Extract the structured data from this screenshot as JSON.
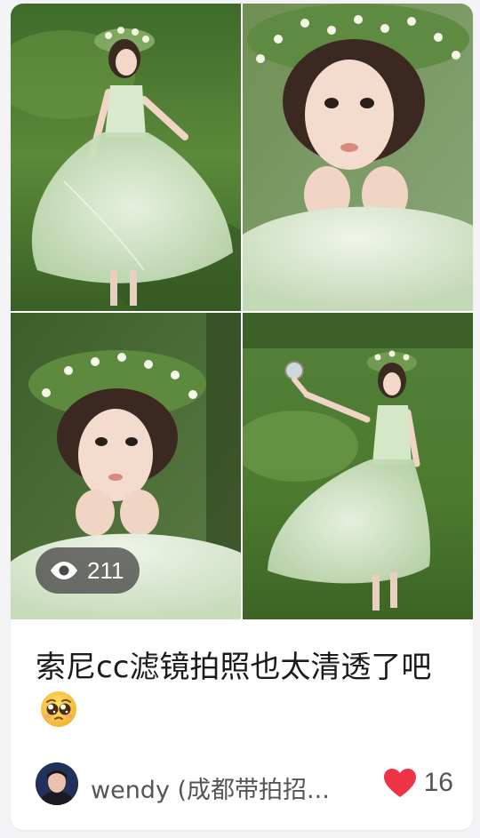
{
  "post": {
    "views": "211",
    "title": "索尼cc滤镜拍照也太清透了吧",
    "title_emoji": "pleading-face",
    "author": "wendy (成都带拍招...",
    "likes": "16"
  },
  "photos": [
    {
      "subject": "woman in green tulle dress dancing on grass"
    },
    {
      "subject": "close-up portrait with flower crown"
    },
    {
      "subject": "portrait with daisy flower crown"
    },
    {
      "subject": "woman holding hand mirror in forest"
    }
  ],
  "colors": {
    "heart": "#ee3344",
    "dress": "#cfe3c2",
    "grass": "#4c7a2e"
  }
}
